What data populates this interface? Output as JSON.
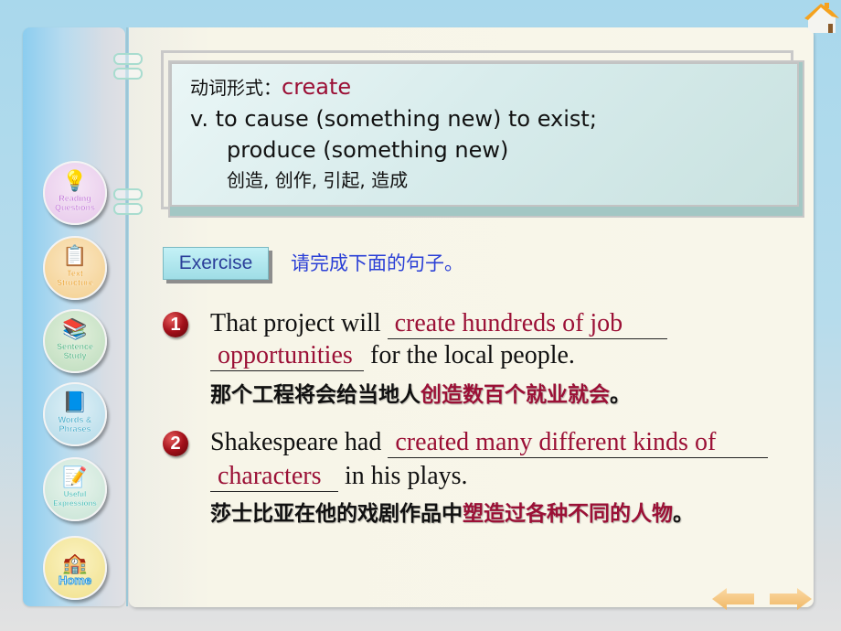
{
  "sidebar": {
    "items": [
      {
        "label_line1": "Reading",
        "label_line2": "Questions",
        "icon": "lightbulb-icon",
        "bg": "#ecd2ee",
        "color": "#c47ad8"
      },
      {
        "label_line1": "Text",
        "label_line2": "Structure",
        "icon": "board-icon",
        "bg": "#f6d49c",
        "color": "#eba028"
      },
      {
        "label_line1": "Sentence",
        "label_line2": "Study",
        "icon": "books-icon",
        "bg": "#c9e2c6",
        "color": "#4fb37e"
      },
      {
        "label_line1": "Words &",
        "label_line2": "Phrases",
        "icon": "book-icon",
        "bg": "#bde0ec",
        "color": "#3aa6c6"
      },
      {
        "label_line1": "Useful",
        "label_line2": "Expressions",
        "icon": "notepad-pencil-icon",
        "bg": "#cde6da",
        "color": "#3bb8b0"
      },
      {
        "label_line1": "",
        "label_line2": "Home",
        "icon": "building-icon",
        "bg": "#f3e89a",
        "color": "#2f9be0"
      }
    ]
  },
  "definition": {
    "label": "动词形式：",
    "word": "create",
    "meaning_line1": "v. to cause (something new) to exist;",
    "meaning_line2": "produce (something new)",
    "chinese": "创造, 创作, 引起, 造成"
  },
  "exercise": {
    "button_label": "Exercise",
    "instruction": "请完成下面的句子。"
  },
  "questions": [
    {
      "number": "1",
      "prefix": "That project will ",
      "answer_part1": "create hundreds of job",
      "answer_part2": "opportunities",
      "suffix": " for the local people.",
      "chinese_plain": "那个工程将会给当地人",
      "chinese_highlight": "创造数百个就业就会",
      "chinese_end": "。"
    },
    {
      "number": "2",
      "prefix": "Shakespeare had ",
      "answer_part1": "created many different kinds of",
      "answer_part2": "characters",
      "suffix": " in his plays.",
      "chinese_plain": "莎士比亚在他的戏剧作品中",
      "chinese_highlight": "塑造过各种不同的人物",
      "chinese_end": "。"
    }
  ],
  "navigation": {
    "prev_icon": "arrow-left-icon",
    "next_icon": "arrow-right-icon",
    "home_icon": "house-icon"
  },
  "colors": {
    "answer": "#9b1036",
    "instruction": "#2a3fd6",
    "arrow": "#f5c57c"
  }
}
